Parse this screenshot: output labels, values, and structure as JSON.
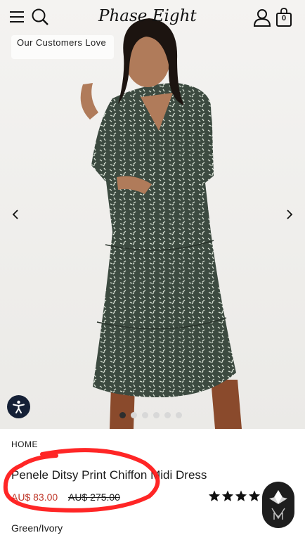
{
  "header": {
    "logo_text": "Phase Eight",
    "bag_count": "0",
    "icons": [
      "menu-icon",
      "search-icon",
      "account-icon",
      "bag-icon"
    ]
  },
  "hero": {
    "badge": "Our Customers Love",
    "slides": {
      "total": 6,
      "active": 1
    }
  },
  "product": {
    "breadcrumb": "HOME",
    "title": "Penele Ditsy Print Chiffon Midi Dress",
    "price_sale": "AU$ 83.00",
    "price_original": "AU$ 275.00",
    "rating_stars": 4,
    "colour": "Green/Ivory"
  },
  "colors": {
    "sale": "#c0392b",
    "annotation": "#ff1a1a",
    "accessibility_button": "#152036"
  }
}
